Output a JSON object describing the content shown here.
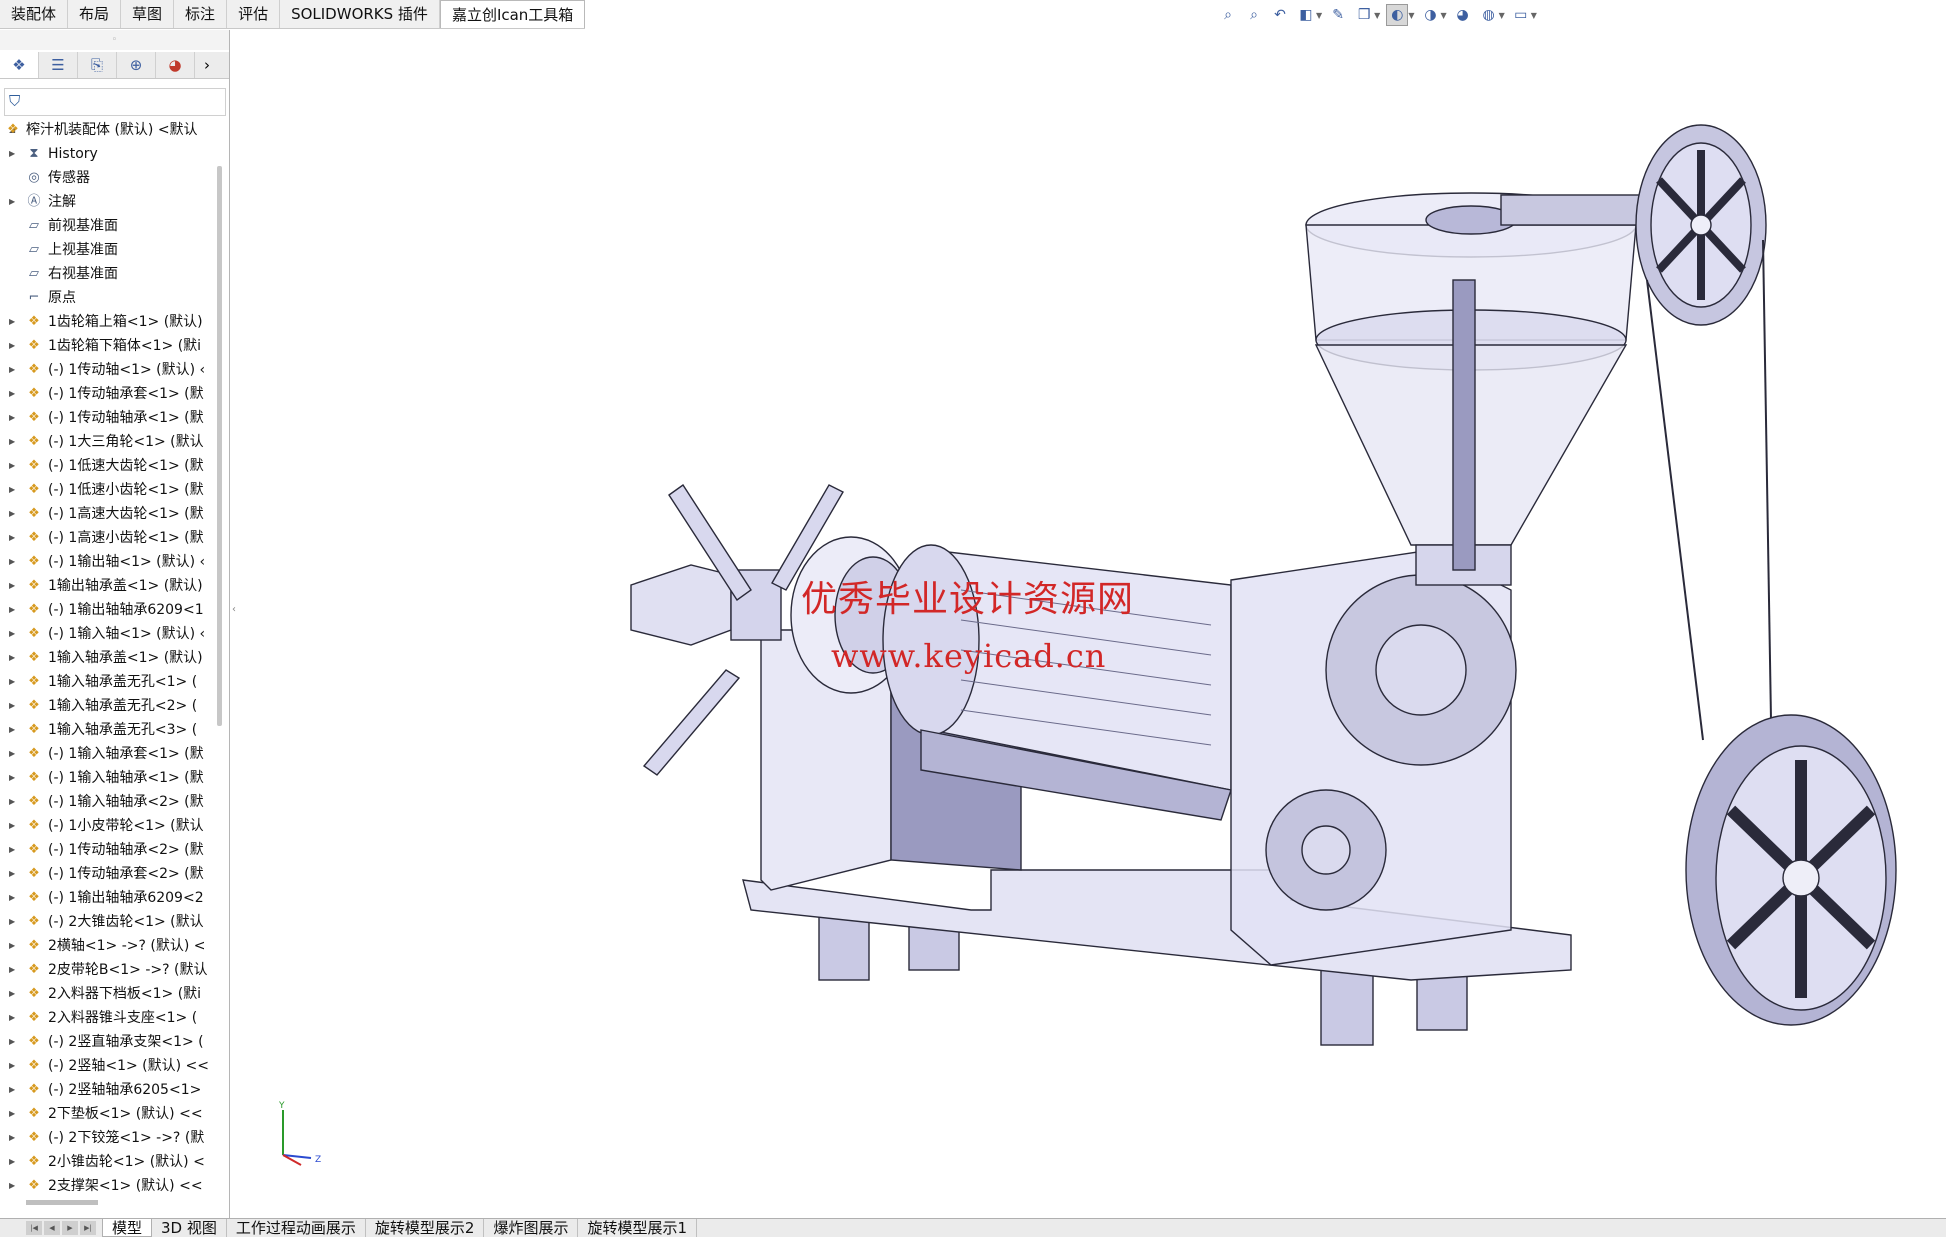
{
  "command_tabs": [
    {
      "label": "装配体",
      "active": false
    },
    {
      "label": "布局",
      "active": false
    },
    {
      "label": "草图",
      "active": false
    },
    {
      "label": "标注",
      "active": false
    },
    {
      "label": "评估",
      "active": false
    },
    {
      "label": "SOLIDWORKS 插件",
      "active": false
    },
    {
      "label": "嘉立创Ican工具箱",
      "active": true
    }
  ],
  "heads_up_toolbar": [
    "zoom-to-fit-icon",
    "zoom-area-icon",
    "previous-view-icon",
    "section-view-icon",
    "dynamic-annotation-icon",
    "view-orientation-icon",
    "display-style-icon",
    "hide-show-icon",
    "edit-appearance-icon",
    "apply-scene-icon",
    "view-settings-icon"
  ],
  "panel_tabs": [
    "featuremanager-icon",
    "propertymanager-icon",
    "configurationmanager-icon",
    "dimxpertmanager-icon",
    "displaymanager-icon"
  ],
  "tree": {
    "root": "榨汁机装配体 (默认) <默认",
    "items": [
      {
        "label": "History",
        "icon": "history",
        "expand": true
      },
      {
        "label": "传感器",
        "icon": "sensor",
        "expand": false
      },
      {
        "label": "注解",
        "icon": "annotation",
        "expand": true
      },
      {
        "label": "前视基准面",
        "icon": "plane",
        "expand": false
      },
      {
        "label": "上视基准面",
        "icon": "plane",
        "expand": false
      },
      {
        "label": "右视基准面",
        "icon": "plane",
        "expand": false
      },
      {
        "label": "原点",
        "icon": "origin",
        "expand": false
      },
      {
        "label": "1齿轮箱上箱<1> (默认)",
        "icon": "part",
        "expand": true
      },
      {
        "label": "1齿轮箱下箱体<1> (默i",
        "icon": "part",
        "expand": true
      },
      {
        "label": "(-) 1传动轴<1> (默认) ‹",
        "icon": "part",
        "expand": true
      },
      {
        "label": "(-) 1传动轴承套<1> (默",
        "icon": "part",
        "expand": true
      },
      {
        "label": "(-) 1传动轴轴承<1> (默",
        "icon": "part",
        "expand": true
      },
      {
        "label": "(-) 1大三角轮<1> (默认",
        "icon": "part",
        "expand": true
      },
      {
        "label": "(-) 1低速大齿轮<1> (默",
        "icon": "part",
        "expand": true
      },
      {
        "label": "(-) 1低速小齿轮<1> (默",
        "icon": "part",
        "expand": true
      },
      {
        "label": "(-) 1高速大齿轮<1> (默",
        "icon": "part",
        "expand": true
      },
      {
        "label": "(-) 1高速小齿轮<1> (默",
        "icon": "part",
        "expand": true
      },
      {
        "label": "(-) 1输出轴<1> (默认) ‹",
        "icon": "part",
        "expand": true
      },
      {
        "label": "1输出轴承盖<1> (默认)",
        "icon": "part",
        "expand": true
      },
      {
        "label": "(-) 1输出轴轴承6209<1",
        "icon": "part",
        "expand": true
      },
      {
        "label": "(-) 1输入轴<1> (默认) ‹",
        "icon": "part",
        "expand": true
      },
      {
        "label": "1输入轴承盖<1> (默认)",
        "icon": "part",
        "expand": true
      },
      {
        "label": "1输入轴承盖无孔<1> (",
        "icon": "part",
        "expand": true
      },
      {
        "label": "1输入轴承盖无孔<2> (",
        "icon": "part",
        "expand": true
      },
      {
        "label": "1输入轴承盖无孔<3> (",
        "icon": "part",
        "expand": true
      },
      {
        "label": "(-) 1输入轴承套<1> (默",
        "icon": "part",
        "expand": true
      },
      {
        "label": "(-) 1输入轴轴承<1> (默",
        "icon": "part",
        "expand": true
      },
      {
        "label": "(-) 1输入轴轴承<2> (默",
        "icon": "part",
        "expand": true
      },
      {
        "label": "(-) 1小皮带轮<1> (默认",
        "icon": "part",
        "expand": true
      },
      {
        "label": "(-) 1传动轴轴承<2> (默",
        "icon": "part",
        "expand": true
      },
      {
        "label": "(-) 1传动轴承套<2> (默",
        "icon": "part",
        "expand": true
      },
      {
        "label": "(-) 1输出轴轴承6209<2",
        "icon": "part",
        "expand": true
      },
      {
        "label": "(-) 2大锥齿轮<1> (默认",
        "icon": "part",
        "expand": true
      },
      {
        "label": "2横轴<1> ->? (默认) <",
        "icon": "part",
        "expand": true
      },
      {
        "label": "2皮带轮B<1> ->? (默认",
        "icon": "part",
        "expand": true
      },
      {
        "label": "2入料器下档板<1> (默i",
        "icon": "part",
        "expand": true
      },
      {
        "label": "2入料器锥斗支座<1> (",
        "icon": "part",
        "expand": true
      },
      {
        "label": "(-) 2竖直轴承支架<1> (",
        "icon": "part",
        "expand": true
      },
      {
        "label": "(-) 2竖轴<1> (默认) <<",
        "icon": "part",
        "expand": true
      },
      {
        "label": "(-) 2竖轴轴承6205<1>",
        "icon": "part",
        "expand": true
      },
      {
        "label": "2下垫板<1> (默认) <<",
        "icon": "part",
        "expand": true
      },
      {
        "label": "(-) 2下铰笼<1> ->? (默",
        "icon": "part",
        "expand": true
      },
      {
        "label": "2小锥齿轮<1> (默认) <",
        "icon": "part",
        "expand": true
      },
      {
        "label": "2支撑架<1> (默认) <<",
        "icon": "part",
        "expand": true
      }
    ]
  },
  "watermark": {
    "line1": "优秀毕业设计资源网",
    "line2": "www.keyicad.cn",
    "color": "#d22727"
  },
  "triad": {
    "y": "Y",
    "z": "Z"
  },
  "bottom_tabs": [
    {
      "label": "模型",
      "active": true
    },
    {
      "label": "3D 视图",
      "active": false
    },
    {
      "label": "工作过程动画展示",
      "active": false
    },
    {
      "label": "旋转模型展示2",
      "active": false
    },
    {
      "label": "爆炸图展示",
      "active": false
    },
    {
      "label": "旋转模型展示1",
      "active": false
    }
  ],
  "colors": {
    "model_fill": "#dcdcf0",
    "model_dark": "#8a8ab0",
    "edge": "#2a2a3a"
  }
}
